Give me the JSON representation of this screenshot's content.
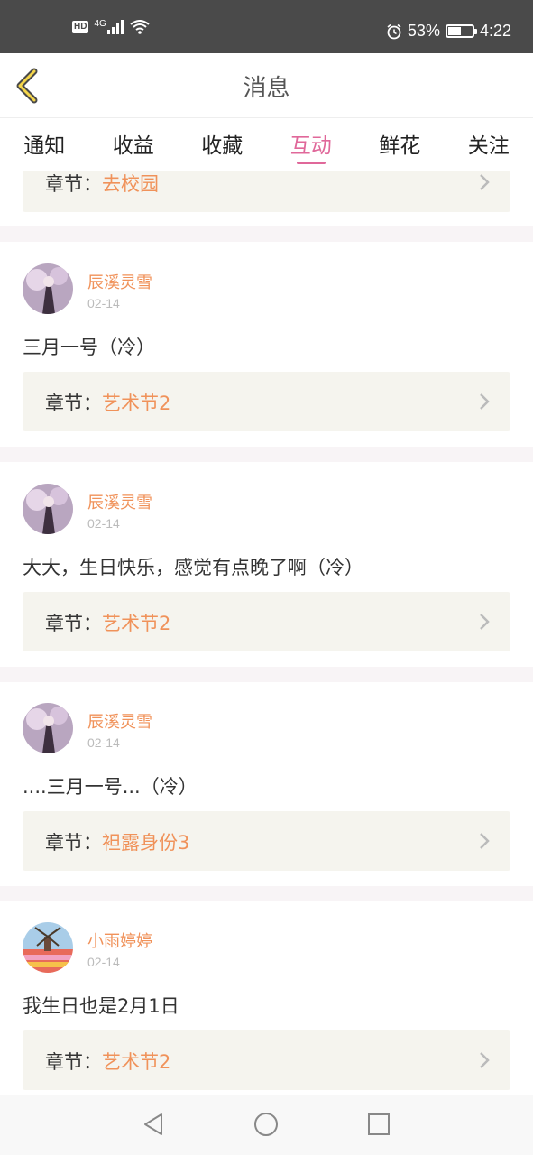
{
  "status_bar": {
    "hd": "HD",
    "network": "4G",
    "battery_text": "53%",
    "battery_level": 0.53,
    "time": "4:22"
  },
  "header": {
    "title": "消息"
  },
  "tabs": [
    {
      "label": "通知"
    },
    {
      "label": "收益"
    },
    {
      "label": "收藏"
    },
    {
      "label": "互动",
      "active": true
    },
    {
      "label": "鲜花"
    },
    {
      "label": "关注"
    }
  ],
  "chapter_prefix": "章节：",
  "partial_item": {
    "chapter": "去校园"
  },
  "items": [
    {
      "user": "辰溪灵雪",
      "date": "02-14",
      "message": "三月一号（冷）",
      "chapter": "艺术节2",
      "avatar": "avatar-girl-icon"
    },
    {
      "user": "辰溪灵雪",
      "date": "02-14",
      "message": "大大，生日快乐，感觉有点晚了啊（冷）",
      "chapter": "艺术节2",
      "avatar": "avatar-girl-icon"
    },
    {
      "user": "辰溪灵雪",
      "date": "02-14",
      "message": "....三月一号...（冷）",
      "chapter": "袒露身份3",
      "avatar": "avatar-girl-icon"
    },
    {
      "user": "小雨婷婷",
      "date": "02-14",
      "message": "我生日也是2月1日",
      "chapter": "艺术节2",
      "avatar": "avatar-windmill-icon"
    }
  ],
  "colors": {
    "accent": "#e0689a",
    "name": "#f0925a",
    "chapter_bg": "#f5f4ee"
  }
}
